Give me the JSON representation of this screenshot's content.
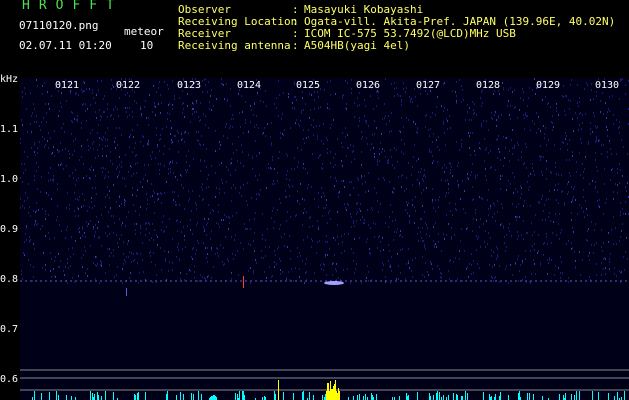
{
  "header": {
    "brand": "HROFFT",
    "filename": "07110120.png",
    "datetime": "02.07.11 01:20",
    "meteor_label": "meteor",
    "meteor_count": "10"
  },
  "info": [
    {
      "label": "Observer",
      "value": "Masayuki Kobayashi"
    },
    {
      "label": "Receiving Location",
      "value": "Ogata-vill. Akita-Pref. JAPAN (139.96E, 40.02N)"
    },
    {
      "label": "Receiver",
      "value": "ICOM IC-575 53.7492(@LCD)MHz USB"
    },
    {
      "label": "Receiving antenna",
      "value": "A504HB(yagi 4el)"
    }
  ],
  "axes": {
    "y_unit": "kHz",
    "y_ticks": [
      "1.1",
      "1.0",
      "0.9",
      "0.8",
      "0.7",
      "0.6"
    ],
    "x_ticks": [
      "0121",
      "0122",
      "0123",
      "0124",
      "0125",
      "0126",
      "0127",
      "0128",
      "0129",
      "0130"
    ]
  },
  "colors": {
    "background": "#000018",
    "noise": "#1a1a6e",
    "signal": "#ffff00",
    "echo": "#ff4040",
    "level_line": "#00ffff"
  }
}
